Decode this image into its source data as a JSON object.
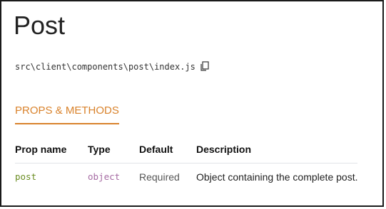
{
  "component": {
    "title": "Post",
    "path": "src\\client\\components\\post\\index.js"
  },
  "tabs": [
    {
      "label": "PROPS & METHODS",
      "active": true
    }
  ],
  "props_table": {
    "headers": {
      "name": "Prop name",
      "type": "Type",
      "default": "Default",
      "description": "Description"
    },
    "rows": [
      {
        "name": "post",
        "type": "object",
        "default": "Required",
        "description": "Object containing the complete post."
      }
    ]
  },
  "icons": {
    "copy": "copy-icon"
  },
  "colors": {
    "accent": "#d9822b",
    "prop_name": "#6b8e23",
    "prop_type": "#a66ba3"
  }
}
